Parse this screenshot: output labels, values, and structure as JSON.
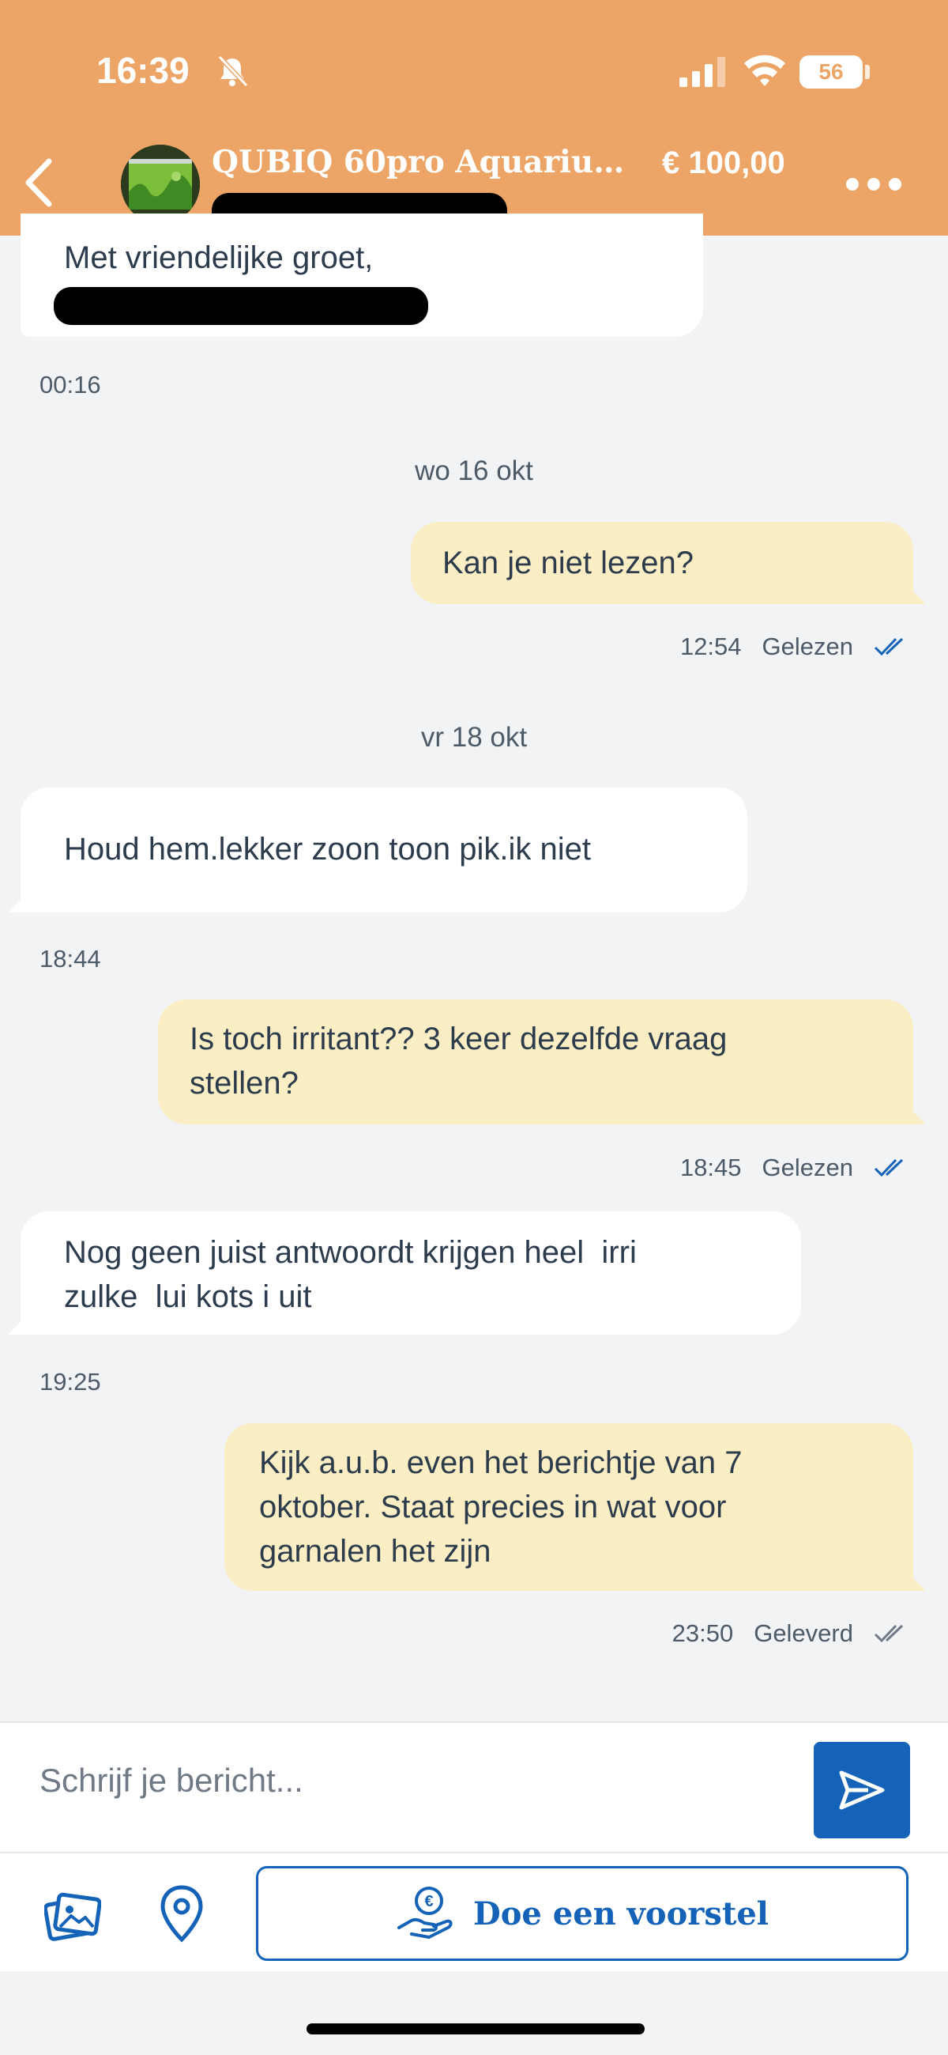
{
  "status_bar": {
    "time": "16:39",
    "battery": "56",
    "battery_level": 0.56
  },
  "header": {
    "title": "QUBIQ 60pro Aquarium...",
    "price": "€ 100,00"
  },
  "messages": [
    {
      "direction": "in",
      "text": "Met vriendelijke groet,",
      "time": "00:16"
    },
    {
      "type": "date",
      "text": "wo 16 okt"
    },
    {
      "direction": "out",
      "text": "Kan je niet lezen?",
      "time": "12:54",
      "status": "Gelezen"
    },
    {
      "type": "date",
      "text": "vr 18 okt"
    },
    {
      "direction": "in",
      "text": "Houd hem.lekker zoon toon pik.ik niet",
      "time": "18:44"
    },
    {
      "direction": "out",
      "lines": [
        "Is toch irritant?? 3 keer dezelfde vraag",
        "stellen?"
      ],
      "time": "18:45",
      "status": "Gelezen"
    },
    {
      "direction": "in",
      "lines": [
        "Nog geen juist antwoordt krijgen heel  irri",
        "zulke  lui kots i uit"
      ],
      "time": "19:25"
    },
    {
      "direction": "out",
      "lines": [
        "Kijk a.u.b. even het berichtje van 7",
        "oktober. Staat precies in wat voor",
        "garnalen het zijn"
      ],
      "time": "23:50",
      "status": "Geleverd"
    }
  ],
  "composer": {
    "placeholder": "Schrijf je bericht...",
    "offer_label": "Doe een voorstel"
  },
  "icons": [
    "bell-muted-icon",
    "signal-icon",
    "wifi-icon",
    "back-icon",
    "more-icon",
    "double-check-icon",
    "send-icon",
    "photo-icon",
    "location-icon",
    "euro-hand-icon"
  ],
  "colors": {
    "header_bg": "#eda567",
    "incoming_bubble": "#ffffff",
    "outgoing_bubble": "#fbeec4",
    "accent": "#1463b8",
    "read_tick": "#1463b8",
    "delivered_tick": "#6f7a86"
  }
}
